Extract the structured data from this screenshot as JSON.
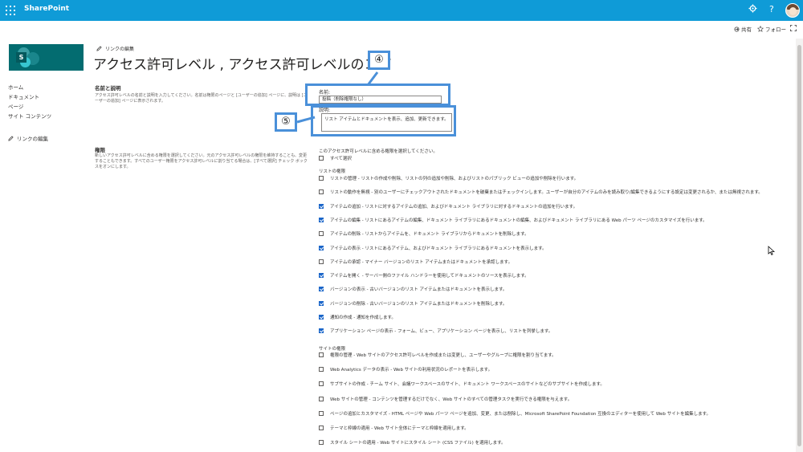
{
  "suite_bar": {
    "app_name": "SharePoint",
    "settings_icon": "gear-icon",
    "help_label": "?",
    "avatar_icon": "user-avatar"
  },
  "command_bar": {
    "share_label": "共有",
    "follow_label": "フォロー"
  },
  "left_nav": {
    "items": [
      "ホーム",
      "ドキュメント",
      "ページ",
      "サイト コンテンツ"
    ],
    "edit_links": "リンクの編集"
  },
  "header": {
    "edit_links": "リンクの編集",
    "page_title": "アクセス許可レベル , アクセス許可レベルのコピ"
  },
  "sections": {
    "name_desc_head": "名前と説明",
    "name_desc_text": "アクセス許可レベルの名前と説明を入力してください。名前は権限のページと [ユーザーの追加] ページに、説明は [ユーザーの追加] ページに表示されます。",
    "perm_head": "権限",
    "perm_text": "新しいアクセス許可レベルに含める権限を選択してください。元のアクセス許可レベルの権限を維持することも、変更することもできます。すべてのユーザー権限をアクセス許可レベルに割り当てる場合は、[すべて選択] チェック ボックスをオンにします。"
  },
  "form": {
    "name_label": "名前:",
    "name_value": "投稿（削除権限なし）",
    "desc_label": "説明:",
    "desc_value": "リスト アイテムとドキュメントを表示、追加、更新できます。"
  },
  "callouts": {
    "four": "④",
    "five": "⑤"
  },
  "permissions": {
    "intro": "このアクセス許可レベルに含める権限を選択してください。",
    "select_all": "すべて選択",
    "list_group": "リストの権限",
    "list_items": [
      {
        "label": "リストの管理 - リストの作成や削除、リストの列の追加や削除、およびリストのパブリック ビューの追加や削除を行います。",
        "checked": false
      },
      {
        "label": "リストの動作を無視 - 別のユーザーにチェックアウトされたドキュメントを破棄またはチェックインします。ユーザーが自分のアイテムのみを読み取り/編集できるようにする設定は変更されるか、または無視されます。",
        "checked": false
      },
      {
        "label": "アイテムの追加 - リストに対するアイテムの追加、およびドキュメント ライブラリに対するドキュメントの追加を行います。",
        "checked": true
      },
      {
        "label": "アイテムの編集 - リストにあるアイテムの編集、ドキュメント ライブラリにあるドキュメントの編集、およびドキュメント ライブラリにある Web パーツ ページのカスタマイズを行います。",
        "checked": true
      },
      {
        "label": "アイテムの削除 - リストからアイテムを、ドキュメント ライブラリからドキュメントを削除します。",
        "checked": false
      },
      {
        "label": "アイテムの表示 - リストにあるアイテム、およびドキュメント ライブラリにあるドキュメントを表示します。",
        "checked": true
      },
      {
        "label": "アイテムの承認 - マイナー バージョンのリスト アイテムまたはドキュメントを承認します。",
        "checked": false
      },
      {
        "label": "アイテムを開く - サーバー側のファイル ハンドラーを使用してドキュメントのソースを表示します。",
        "checked": true
      },
      {
        "label": "バージョンの表示 - 古いバージョンのリスト アイテムまたはドキュメントを表示します。",
        "checked": true
      },
      {
        "label": "バージョンの削除 - 古いバージョンのリスト アイテムまたはドキュメントを削除します。",
        "checked": true
      },
      {
        "label": "通知の作成 - 通知を作成します。",
        "checked": true
      },
      {
        "label": "アプリケーション ページの表示 - フォーム、ビュー、アプリケーション ページを表示し、リストを列挙します。",
        "checked": true
      }
    ],
    "site_group": "サイトの権限",
    "site_items": [
      {
        "label": "権限の管理 - Web サイトのアクセス許可レベルを作成または変更し、ユーザーやグループに権限を割り当てます。",
        "checked": false
      },
      {
        "label": "Web Analytics データの表示 - Web サイトの利用状況のレポートを表示します。",
        "checked": false
      },
      {
        "label": "サブサイトの作成 - チーム サイト、会議ワークスペースのサイト、ドキュメント ワークスペースのサイトなどのサブサイトを作成します。",
        "checked": false
      },
      {
        "label": "Web サイトの管理 - コンテンツを管理するだけでなく、Web サイトのすべての管理タスクを実行できる権限を与えます。",
        "checked": false
      },
      {
        "label": "ページの追加とカスタマイズ - HTML ページや Web パーツ ページを追加、変更、または削除し、Microsoft SharePoint Foundation 互換のエディターを使用して Web サイトを編集します。",
        "checked": false
      },
      {
        "label": "テーマと枠線の適用 - Web サイト全体にテーマと枠線を適用します。",
        "checked": false
      },
      {
        "label": "スタイル シートの適用 - Web サイトにスタイル シート (CSS ファイル) を適用します。",
        "checked": false
      }
    ]
  }
}
